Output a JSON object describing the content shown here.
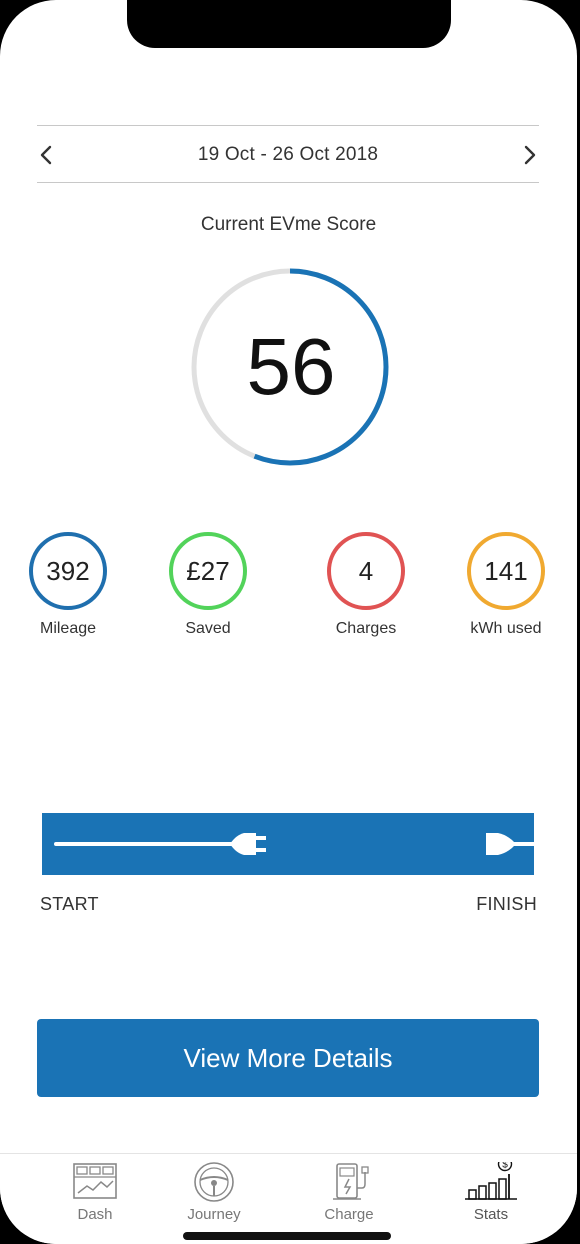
{
  "header": {
    "date_range": "19 Oct - 26 Oct 2018",
    "prev_icon": "chevron-left-icon",
    "next_icon": "chevron-right-icon"
  },
  "score": {
    "title": "Current EVme Score",
    "value": "56",
    "progress": 0.56,
    "ring_color": "#1a73b5",
    "track_color": "#e0e0e0"
  },
  "stats": [
    {
      "value": "392",
      "label": "Mileage",
      "color": "#1f6fae"
    },
    {
      "value": "£27",
      "label": "Saved",
      "color": "#52d35a"
    },
    {
      "value": "4",
      "label": "Charges",
      "color": "#e05353"
    },
    {
      "value": "141",
      "label": "kWh used",
      "color": "#f0a930"
    }
  ],
  "charge_bar": {
    "start_label": "START",
    "finish_label": "FINISH",
    "bar_color": "#1a73b5",
    "icon": "plug-icon"
  },
  "details_button": {
    "label": "View More Details"
  },
  "tabs": [
    {
      "label": "Dash",
      "icon": "dashboard-icon"
    },
    {
      "label": "Journey",
      "icon": "steering-wheel-icon"
    },
    {
      "label": "Charge",
      "icon": "charging-station-icon"
    },
    {
      "label": "Stats",
      "icon": "bar-chart-dollar-icon",
      "active": true
    }
  ]
}
